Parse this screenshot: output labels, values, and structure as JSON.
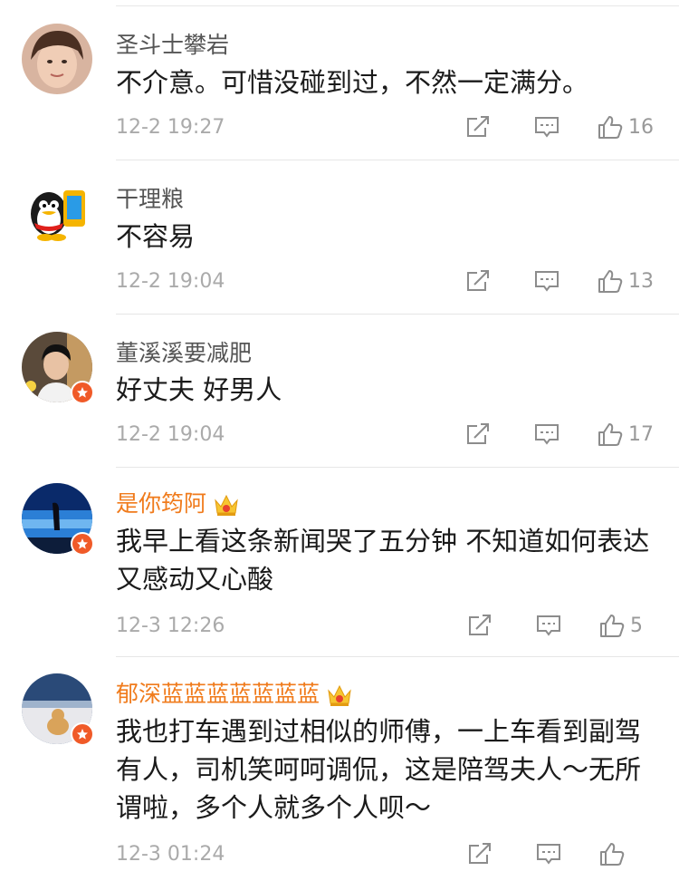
{
  "comments": [
    {
      "username": "圣斗士攀岩",
      "text": "不介意。可惜没碰到过，不然一定满分。",
      "time": "12-2 19:27",
      "likes": "16"
    },
    {
      "username": "干理粮",
      "text": "不容易",
      "time": "12-2 19:04",
      "likes": "13"
    },
    {
      "username": "董溪溪要减肥",
      "text": "好丈夫 好男人",
      "time": "12-2 19:04",
      "likes": "17"
    },
    {
      "username": "是你筠阿",
      "text": "我早上看这条新闻哭了五分钟 不知道如何表达 又感动又心酸",
      "time": "12-3 12:26",
      "likes": "5"
    },
    {
      "username": "郁深蓝蓝蓝蓝蓝蓝蓝",
      "text": "我也打车遇到过相似的师傅，一上车看到副驾有人，司机笑呵呵调侃，这是陪驾夫人～无所谓啦，多个人就多个人呗～",
      "time": "12-3 01:24",
      "likes": ""
    }
  ],
  "colors": {
    "vip_name": "#f07b1c",
    "name": "#555555",
    "meta": "#aaaaaa",
    "badge": "#f05a28"
  },
  "icons": [
    "share-icon",
    "reply-icon",
    "like-icon",
    "verified-badge-icon",
    "vip-crown-icon"
  ]
}
